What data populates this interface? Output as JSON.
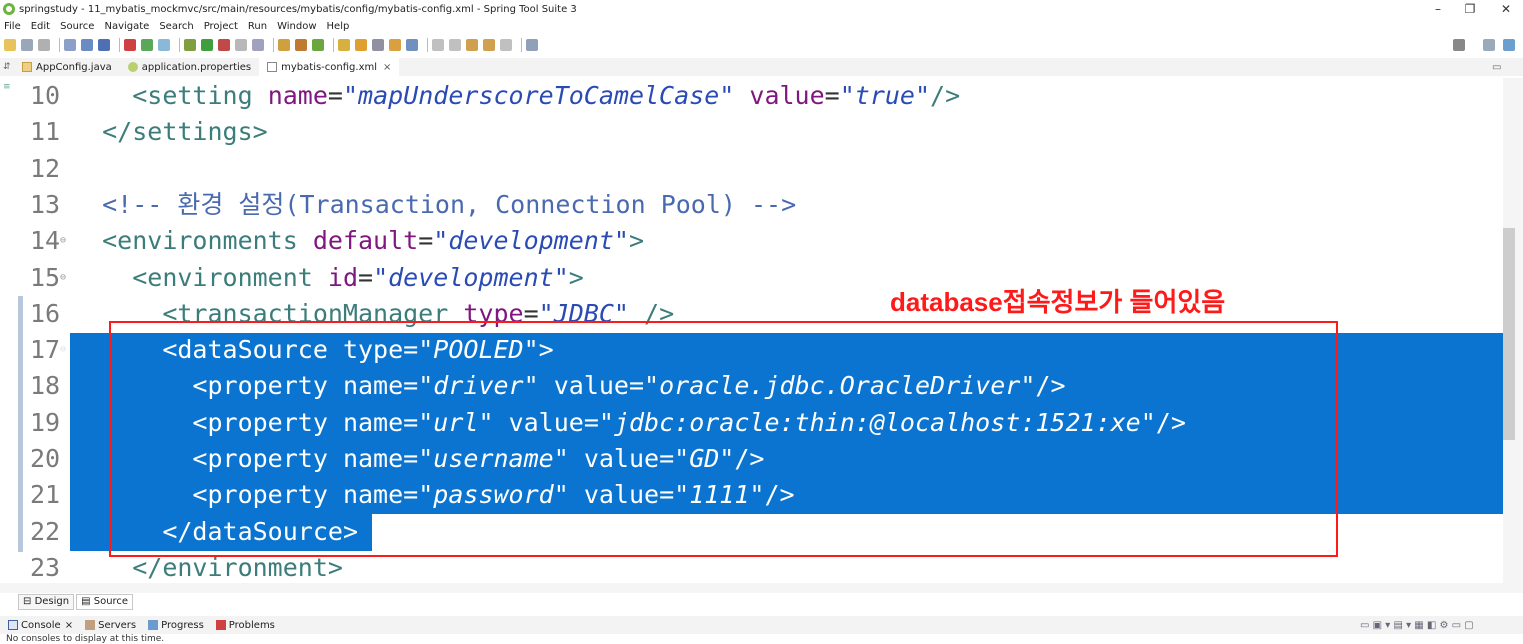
{
  "window": {
    "title": "springstudy - 11_mybatis_mockmvc/src/main/resources/mybatis/config/mybatis-config.xml - Spring Tool Suite 3",
    "minimize": "–",
    "maximize": "❐",
    "close": "✕"
  },
  "menu": [
    "File",
    "Edit",
    "Source",
    "Navigate",
    "Search",
    "Project",
    "Run",
    "Window",
    "Help"
  ],
  "tabs": [
    {
      "label": "AppConfig.java",
      "active": false
    },
    {
      "label": "application.properties",
      "active": false
    },
    {
      "label": "mybatis-config.xml",
      "active": true,
      "close": "×"
    }
  ],
  "editor": {
    "lines": [
      {
        "num": "10",
        "text": "  <setting name=\"mapUnderscoreToCamelCase\" value=\"true\"/>"
      },
      {
        "num": "11",
        "text": "</settings>"
      },
      {
        "num": "12",
        "text": ""
      },
      {
        "num": "13",
        "text": "<!-- 환경 설정(Transaction, Connection Pool) -->"
      },
      {
        "num": "14",
        "text": "<environments default=\"development\">"
      },
      {
        "num": "15",
        "text": "  <environment id=\"development\">"
      },
      {
        "num": "16",
        "text": "    <transactionManager type=\"JDBC\" />"
      },
      {
        "num": "17",
        "text": "    <dataSource type=\"POOLED\">"
      },
      {
        "num": "18",
        "text": "      <property name=\"driver\" value=\"oracle.jdbc.OracleDriver\"/>"
      },
      {
        "num": "19",
        "text": "      <property name=\"url\" value=\"jdbc:oracle:thin:@localhost:1521:xe\"/>"
      },
      {
        "num": "20",
        "text": "      <property name=\"username\" value=\"GD\"/>"
      },
      {
        "num": "21",
        "text": "      <property name=\"password\" value=\"1111\"/>"
      },
      {
        "num": "22",
        "text": "    </dataSource>"
      },
      {
        "num": "23",
        "text": "  </environment>"
      }
    ],
    "annotation": "database접속정보가 들어있음"
  },
  "bottom_tabs": [
    "Design",
    "Source"
  ],
  "console_tabs": [
    {
      "label": "Console",
      "close": "×"
    },
    {
      "label": "Servers"
    },
    {
      "label": "Progress"
    },
    {
      "label": "Problems"
    }
  ],
  "console_message": "No consoles to display at this time.",
  "colors": {
    "selection": "#0a74d0",
    "annotation": "#ff1a1a"
  }
}
